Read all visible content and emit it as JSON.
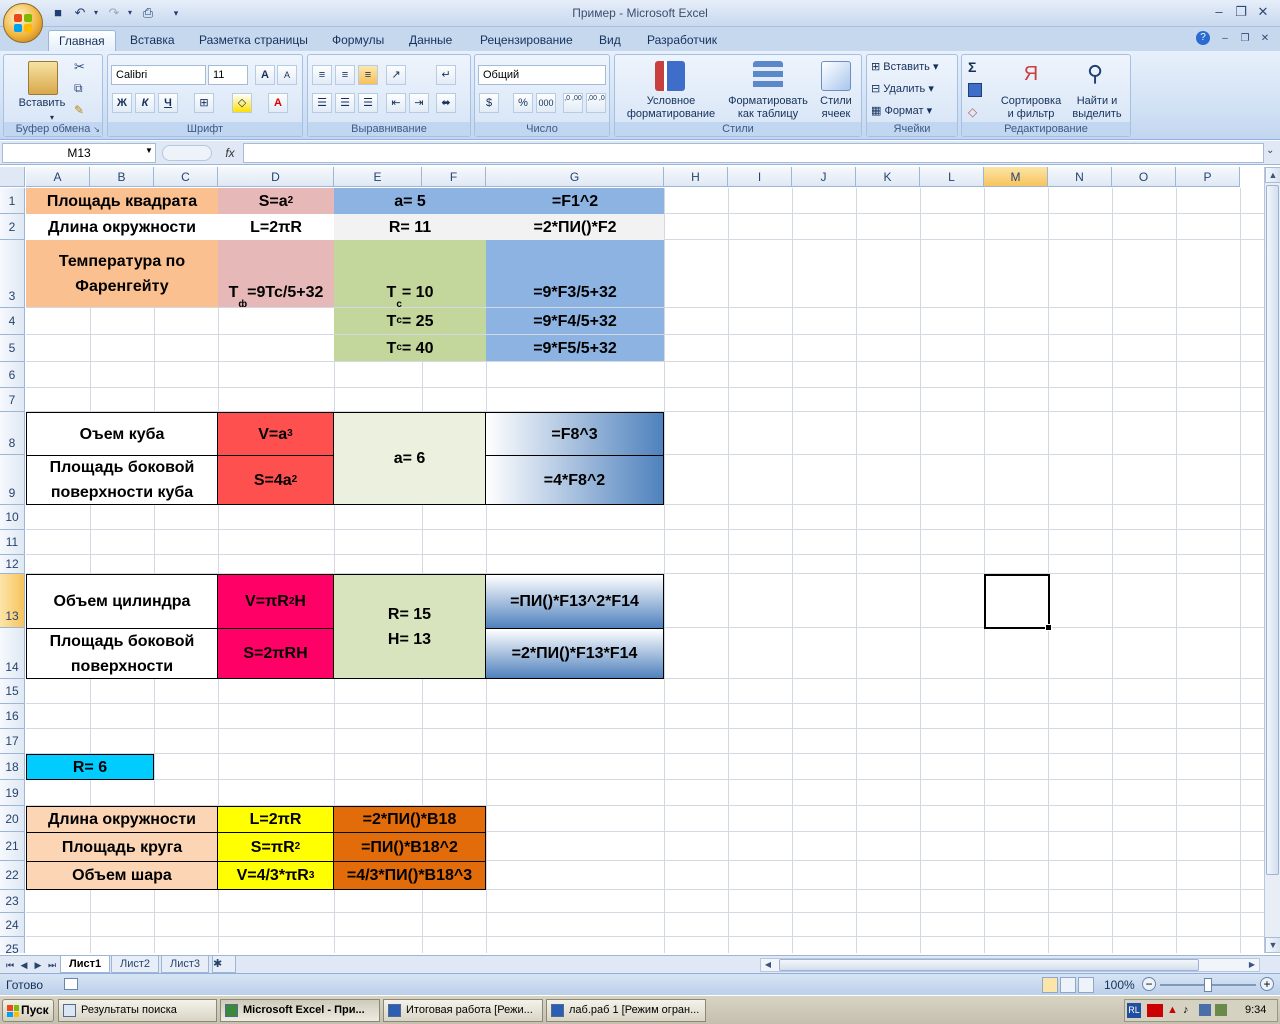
{
  "window": {
    "title": "Пример - Microsoft Excel"
  },
  "ribbon": {
    "tabs": [
      {
        "label": "Главная",
        "active": true
      },
      {
        "label": "Вставка"
      },
      {
        "label": "Разметка страницы"
      },
      {
        "label": "Формулы"
      },
      {
        "label": "Данные"
      },
      {
        "label": "Рецензирование"
      },
      {
        "label": "Вид"
      },
      {
        "label": "Разработчик"
      }
    ],
    "clipboard": {
      "label": "Буфер обмена",
      "paste": "Вставить"
    },
    "font": {
      "label": "Шрифт",
      "name": "Calibri",
      "size": "11",
      "bold": "Ж",
      "italic": "К",
      "underline": "Ч",
      "grow": "A",
      "shrink": "A",
      "color_letter": "A"
    },
    "alignment": {
      "label": "Выравнивание"
    },
    "number": {
      "label": "Число",
      "format": "Общий",
      "percent": "%",
      "thousands": "000",
      "inc_decimal": ",0 ,00",
      "dec_decimal": ",00 ,0"
    },
    "styles": {
      "label": "Стили",
      "conditional": [
        "Условное",
        "форматирование"
      ],
      "as_table": [
        "Форматировать",
        "как таблицу"
      ],
      "cell_styles": [
        "Стили",
        "ячеек"
      ]
    },
    "cells": {
      "label": "Ячейки",
      "insert": "Вставить",
      "delete": "Удалить",
      "format": "Формат"
    },
    "editing": {
      "label": "Редактирование",
      "sum": "Σ",
      "sort": [
        "Сортировка",
        "и фильтр"
      ],
      "find": [
        "Найти и",
        "выделить"
      ]
    }
  },
  "formula_bar": {
    "name_box": "M13",
    "fx": "fx",
    "content": ""
  },
  "sheet": {
    "columns": [
      "A",
      "B",
      "C",
      "D",
      "E",
      "F",
      "G",
      "H",
      "I",
      "J",
      "K",
      "L",
      "M",
      "N",
      "O",
      "P"
    ],
    "selected_column": "M",
    "rows": [
      "1",
      "2",
      "3",
      "4",
      "5",
      "6",
      "7",
      "8",
      "9",
      "10",
      "11",
      "12",
      "13",
      "14",
      "15",
      "16",
      "17",
      "18",
      "19",
      "20",
      "21",
      "22",
      "23",
      "24",
      "25"
    ],
    "selected_row": "13",
    "cells": {
      "abc1": "Площадь квадрата",
      "d1_base": "S=a",
      "d1_exp": "2",
      "ef1": "a=  5",
      "g1": "=F1^2",
      "abc2": "Длина окружности",
      "d2": "L=2πR",
      "ef2": "R=  11",
      "g2": "=2*ПИ()*F2",
      "abc3": "Температура по Фаренгейту",
      "d3_t": "T",
      "d3_sub": "ф",
      "d3_rest": "=9Tc/5+32",
      "ef3_t": "T",
      "ef3_sub": "c",
      "ef3_val": "=  10",
      "g3": "=9*F3/5+32",
      "ef4_t": "T",
      "ef4_sub": "c",
      "ef4_val": "=  25",
      "g4": "=9*F4/5+32",
      "ef5_t": "T",
      "ef5_sub": "c",
      "ef5_val": "=  40",
      "g5": "=9*F5/5+32",
      "abc8": "Оъем куба",
      "d8_base": "V=a",
      "d8_exp": "3",
      "ef89": "a=  6",
      "g8": "=F8^3",
      "abc9": "Площадь боковой поверхности куба",
      "d9_base": "S=4a",
      "d9_exp": "2",
      "g9": "=4*F8^2",
      "abc13": "Объем цилиндра",
      "d13_a": "V=πR",
      "d13_exp": "2",
      "d13_b": "H",
      "ef1314_r": "R=  15",
      "ef1314_h": "H=  13",
      "g13": "=ПИ()*F13^2*F14",
      "abc14": "Площадь боковой поверхности",
      "d14": "S=2πRH",
      "g14": "=2*ПИ()*F13*F14",
      "ab18": "R=  6",
      "abc20": "Длина окружности",
      "d20": "L=2πR",
      "ef20": "=2*ПИ()*B18",
      "abc21": "Площадь круга",
      "d21_base": "S=πR",
      "d21_exp": "2",
      "ef21": "=ПИ()*B18^2",
      "abc22": "Объем шара",
      "d22_base": "V=4/3*πR",
      "d22_exp": "3",
      "ef22": "=4/3*ПИ()*B18^3"
    }
  },
  "sheet_tabs": [
    {
      "label": "Лист1",
      "active": true
    },
    {
      "label": "Лист2"
    },
    {
      "label": "Лист3"
    }
  ],
  "status": {
    "text": "Готово",
    "zoom": "100%"
  },
  "taskbar": {
    "start": "Пуск",
    "tasks": [
      {
        "label": "Результаты поиска"
      },
      {
        "label": "Microsoft Excel - При...",
        "active": true
      },
      {
        "label": "Итоговая работа [Режи..."
      },
      {
        "label": "лаб.раб 1 [Режим огран..."
      }
    ],
    "lang": "RL",
    "clock": "9:34"
  },
  "colors": {
    "orange_light": "#fac090",
    "pink_light": "#e6b9b8",
    "blue_mid": "#8db3e2",
    "gray_light": "#f2f2f2",
    "green_olive": "#c3d69b",
    "red": "#ff5050",
    "green_pale": "#ebf1de",
    "magenta": "#ff0066",
    "green_mid": "#d7e4bd",
    "cyan": "#00ccff",
    "peach": "#fcd5b4",
    "yellow": "#ffff00",
    "orange_dark": "#e26b0a"
  }
}
